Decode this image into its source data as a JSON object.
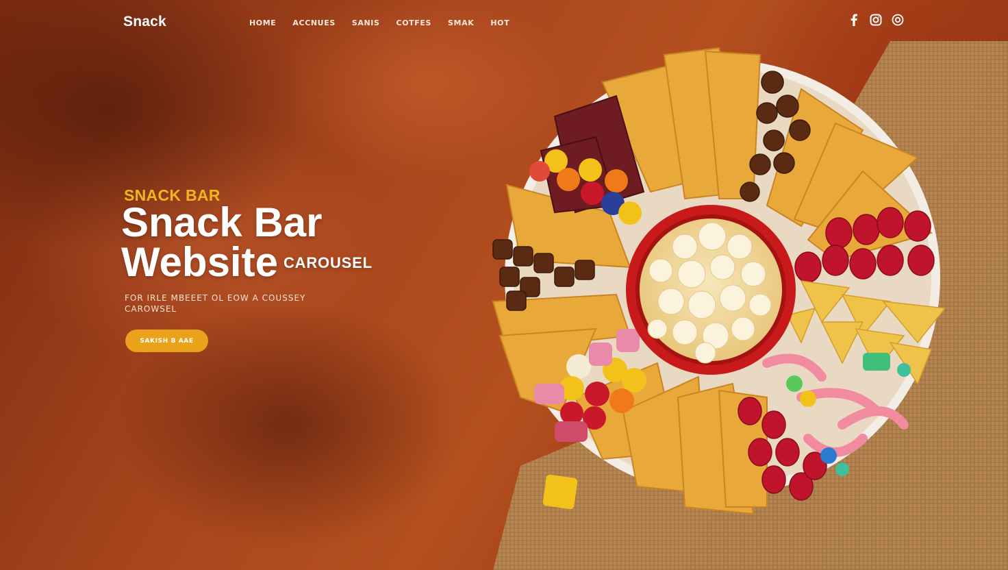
{
  "header": {
    "logo": "Snack",
    "nav": [
      {
        "label": "HOME"
      },
      {
        "label": "ACCNUES"
      },
      {
        "label": "SANIS"
      },
      {
        "label": "COTFES"
      },
      {
        "label": "SMAK"
      },
      {
        "label": "HOT"
      }
    ],
    "social": [
      {
        "icon": "facebook-icon"
      },
      {
        "icon": "instagram-icon"
      },
      {
        "icon": "pinterest-icon"
      }
    ]
  },
  "hero": {
    "eyebrow": "SNACK BAR",
    "headline_line1": "Snack Bar",
    "headline_line2": "Website",
    "headline_suffix": "CAROUSEL",
    "subtitle": "FOR IRLE MBEEET OL EOW A COUSSEY CAROWSEL",
    "cta_label": "SAKISH B AAE"
  },
  "colors": {
    "accent": "#f2b51e",
    "button": "#e9a21a",
    "background": "#a8461d",
    "bowl": "#d42a1c"
  }
}
